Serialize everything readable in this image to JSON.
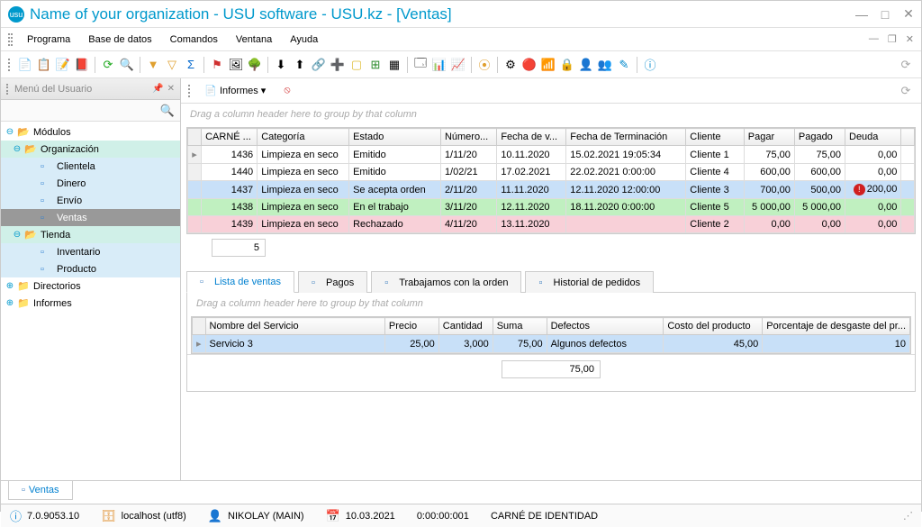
{
  "window": {
    "title": "Name of your organization - USU software - USU.kz - [Ventas]"
  },
  "menu": {
    "items": [
      "Programa",
      "Base de datos",
      "Comandos",
      "Ventana",
      "Ayuda"
    ]
  },
  "sidebar": {
    "title": "Menú del Usuario",
    "tree": {
      "modulos": "Módulos",
      "organizacion": "Organización",
      "clientela": "Clientela",
      "dinero": "Dinero",
      "envio": "Envío",
      "ventas": "Ventas",
      "tienda": "Tienda",
      "inventario": "Inventario",
      "producto": "Producto",
      "directorios": "Directorios",
      "informes": "Informes"
    }
  },
  "subtoolbar": {
    "informes": "Informes"
  },
  "mainGrid": {
    "groupHint": "Drag a column header here to group by that column",
    "cols": [
      "CARNÉ ...",
      "Categoría",
      "Estado",
      "Número...",
      "Fecha de v...",
      "Fecha de Terminación",
      "Cliente",
      "Pagar",
      "Pagado",
      "Deuda"
    ],
    "rows": [
      {
        "id": "1436",
        "cat": "Limpieza en seco",
        "estado": "Emitido",
        "num": "1/11/20",
        "fv": "10.11.2020",
        "ft": "15.02.2021 19:05:34",
        "cli": "Cliente 1",
        "pagar": "75,00",
        "pagado": "75,00",
        "deuda": "0,00",
        "cls": ""
      },
      {
        "id": "1440",
        "cat": "Limpieza en seco",
        "estado": "Emitido",
        "num": "1/02/21",
        "fv": "17.02.2021",
        "ft": "22.02.2021 0:00:00",
        "cli": "Cliente 4",
        "pagar": "600,00",
        "pagado": "600,00",
        "deuda": "0,00",
        "cls": ""
      },
      {
        "id": "1437",
        "cat": "Limpieza en seco",
        "estado": "Se acepta orden",
        "num": "2/11/20",
        "fv": "11.11.2020",
        "ft": "12.11.2020 12:00:00",
        "cli": "Cliente 3",
        "pagar": "700,00",
        "pagado": "500,00",
        "deuda": "200,00",
        "cls": "r-blue",
        "warn": true
      },
      {
        "id": "1438",
        "cat": "Limpieza en seco",
        "estado": "En el trabajo",
        "num": "3/11/20",
        "fv": "12.11.2020",
        "ft": "18.11.2020 0:00:00",
        "cli": "Cliente 5",
        "pagar": "5 000,00",
        "pagado": "5 000,00",
        "deuda": "0,00",
        "cls": "r-green"
      },
      {
        "id": "1439",
        "cat": "Limpieza en seco",
        "estado": "Rechazado",
        "num": "4/11/20",
        "fv": "13.11.2020",
        "ft": "",
        "cli": "Cliente 2",
        "pagar": "0,00",
        "pagado": "0,00",
        "deuda": "0,00",
        "cls": "r-pink"
      }
    ],
    "count": "5"
  },
  "tabs": {
    "lista": "Lista de ventas",
    "pagos": "Pagos",
    "trabajamos": "Trabajamos con la orden",
    "historial": "Historial de pedidos"
  },
  "detailGrid": {
    "groupHint": "Drag a column header here to group by that column",
    "cols": [
      "Nombre del Servicio",
      "Precio",
      "Cantidad",
      "Suma",
      "Defectos",
      "Costo del producto",
      "Porcentaje de desgaste del pr..."
    ],
    "rows": [
      {
        "nombre": "Servicio 3",
        "precio": "25,00",
        "cant": "3,000",
        "suma": "75,00",
        "def": "Algunos defectos",
        "costo": "45,00",
        "pct": "10"
      }
    ],
    "sum": "75,00"
  },
  "bottomTab": "Ventas",
  "status": {
    "ver": "7.0.9053.10",
    "host": "localhost (utf8)",
    "user": "NIKOLAY (MAIN)",
    "date": "10.03.2021",
    "time": "0:00:00:001",
    "id": "CARNÉ DE IDENTIDAD"
  }
}
